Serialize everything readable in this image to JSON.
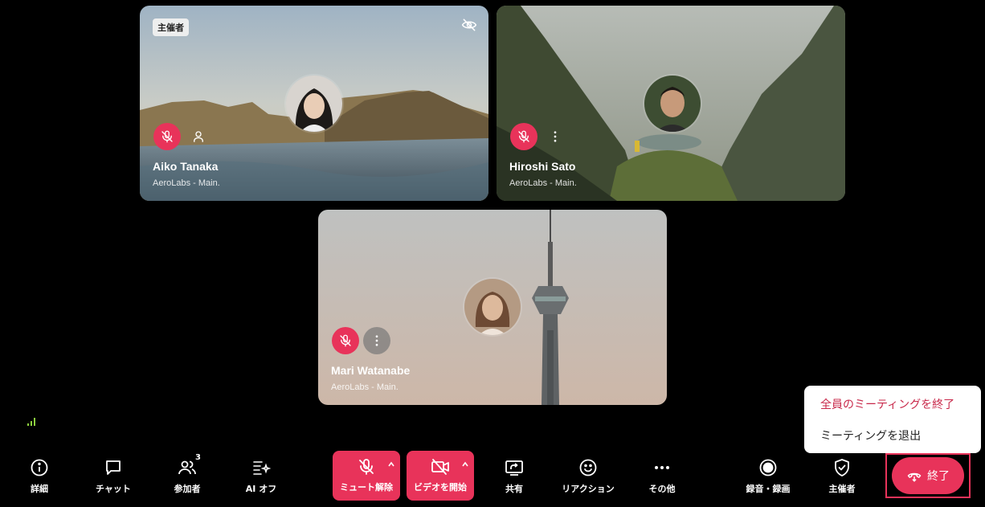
{
  "participants": [
    {
      "name": "Aiko Tanaka",
      "subtitle": "AeroLabs - Main.",
      "badge": "主催者",
      "muted": true,
      "video_hidden_icon": "eye-off-icon",
      "action_icon": "person-icon"
    },
    {
      "name": "Hiroshi Sato",
      "subtitle": "AeroLabs - Main.",
      "muted": true,
      "action_icon": "more-vertical-icon"
    },
    {
      "name": "Mari Watanabe",
      "subtitle": "AeroLabs - Main.",
      "muted": true,
      "action_icon": "more-vertical-icon"
    }
  ],
  "toolbar": {
    "details": "詳細",
    "chat": "チャット",
    "participants": "参加者",
    "participants_count": "3",
    "ai": "AI オフ",
    "unmute": "ミュート解除",
    "start_video": "ビデオを開始",
    "share": "共有",
    "reactions": "リアクション",
    "more": "その他",
    "record": "録音・録画",
    "host": "主催者",
    "end": "終了"
  },
  "end_menu": {
    "end_for_all": "全員のミーティングを終了",
    "leave": "ミーティングを退出"
  },
  "colors": {
    "accent": "#e8335a",
    "end_for_all_text": "#c8284a",
    "background": "#000000"
  }
}
